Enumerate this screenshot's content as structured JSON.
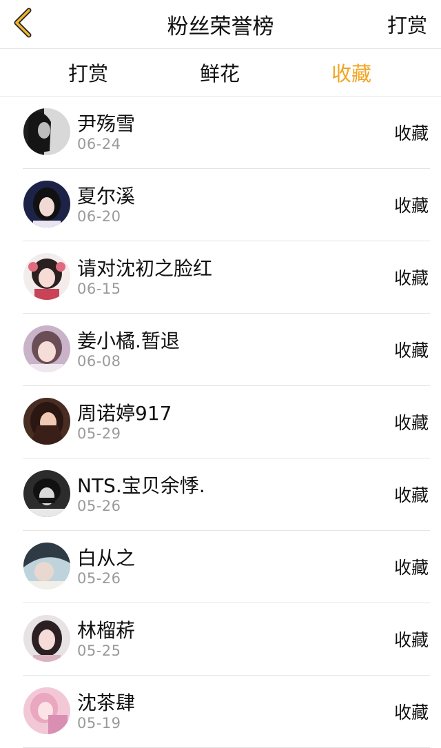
{
  "header": {
    "title": "粉丝荣誉榜",
    "right_label": "打赏",
    "accent_color": "#f1a421"
  },
  "tabs": [
    {
      "label": "打赏",
      "active": false
    },
    {
      "label": "鲜花",
      "active": false
    },
    {
      "label": "收藏",
      "active": true
    }
  ],
  "fans": [
    {
      "name": "尹殇雪",
      "date": "06-24",
      "action": "收藏"
    },
    {
      "name": "夏尔溪",
      "date": "06-20",
      "action": "收藏"
    },
    {
      "name": "请对沈初之脸红",
      "date": "06-15",
      "action": "收藏"
    },
    {
      "name": "姜小橘.暂退",
      "date": "06-08",
      "action": "收藏"
    },
    {
      "name": "周诺婷917",
      "date": "05-29",
      "action": "收藏"
    },
    {
      "name": "NTS.宝贝余悸.",
      "date": "05-26",
      "action": "收藏"
    },
    {
      "name": "白从之",
      "date": "05-26",
      "action": "收藏"
    },
    {
      "name": "林榴菥",
      "date": "05-25",
      "action": "收藏"
    },
    {
      "name": "沈茶肆",
      "date": "05-19",
      "action": "收藏"
    }
  ]
}
